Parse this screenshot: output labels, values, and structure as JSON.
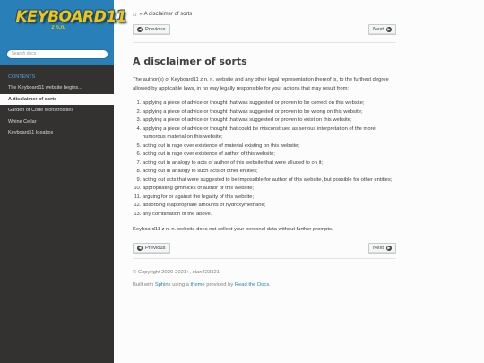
{
  "sidebar": {
    "logo_text": "KEYBOARD11",
    "logo_sub": "z n.n.",
    "search_placeholder": "Search docs",
    "toc_caption": "CONTENTS",
    "items": [
      {
        "label": "The Keyboard11 website begins..."
      },
      {
        "label": "A disclaimer of sorts"
      },
      {
        "label": "Garden of Code Monstrosities"
      },
      {
        "label": "Whine Cellar"
      },
      {
        "label": "Keyboard11 Ideabox"
      }
    ]
  },
  "breadcrumb": {
    "separator": "»",
    "current": "A disclaimer of sorts"
  },
  "nav": {
    "prev_label": "Previous",
    "next_label": "Next"
  },
  "page": {
    "title": "A disclaimer of sorts",
    "intro": "The author(s) of Keyboard11 z n. n. website and any other legal representation thereof is, to the furthest degree allowed by applicable laws, in no way legally responsible for your actions that may result from:",
    "items": [
      "applying a piece of advice or thought that was suggested or proven to be correct on this website;",
      "applying a piece of advice or thought that was suggested or proven to be wrong on this website;",
      "applying a piece of advice or thought that was suggested or proven to exist on this website;",
      "applying a piece of advice or thought that could be misconstrued as serious interpretation of the more humorous material on this website;",
      "acting out in rage over existence of material existing on this website;",
      "acting out in rage over existence of author of this website;",
      "acting out in analogy to acts of author of this website that were alluded to on it;",
      "acting out in analogy to such acts of other entities;",
      "acting out acts that were suggested to be impossible for author of this website, but possible for other entities;",
      "appropriating gimmicks of author of this website;",
      "arguing for or against the legality of this website;",
      "absorbing inappropriate amounts of hydroxymethane;",
      "any combination of the above."
    ],
    "outro": "Keyboard11 z n. n. website does not collect your personal data without further prompts."
  },
  "footer": {
    "copyright": "© Copyright 2020-2021+, stan423321.",
    "built_with": "Built with",
    "sphinx": "Sphinx",
    "using_a": "using a",
    "theme": "theme",
    "provided_by": "provided by",
    "rtd": "Read the Docs",
    "period": "."
  }
}
